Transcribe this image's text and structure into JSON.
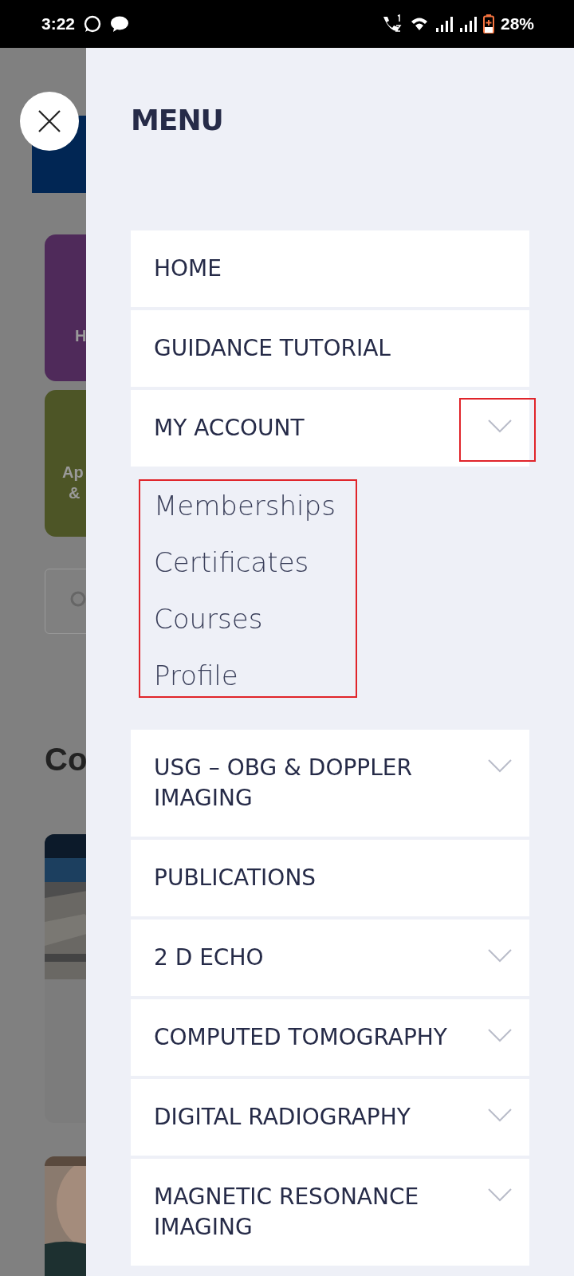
{
  "status_bar": {
    "time": "3:22",
    "battery": "28%"
  },
  "background": {
    "tile_1_text": "H",
    "tile_2_lines": [
      "Ap",
      "&"
    ],
    "section_heading": "Co"
  },
  "menu": {
    "title": "MENU",
    "items": [
      {
        "label": "HOME",
        "expandable": false,
        "annotated": false
      },
      {
        "label": "GUIDANCE TUTORIAL",
        "expandable": false,
        "annotated": false
      },
      {
        "label": "MY ACCOUNT",
        "expandable": true,
        "expanded": true,
        "annotated": true,
        "children": [
          {
            "label": "Memberships"
          },
          {
            "label": "Certificates"
          },
          {
            "label": "Courses"
          },
          {
            "label": "Profile"
          }
        ]
      },
      {
        "label": "USG – OBG & DOPPLER IMAGING",
        "expandable": true,
        "annotated": false
      },
      {
        "label": "PUBLICATIONS",
        "expandable": false,
        "annotated": false
      },
      {
        "label": "2 D ECHO",
        "expandable": true,
        "annotated": false
      },
      {
        "label": "COMPUTED TOMOGRAPHY",
        "expandable": true,
        "annotated": false
      },
      {
        "label": "DIGITAL RADIOGRAPHY",
        "expandable": true,
        "annotated": false
      },
      {
        "label": "MAGNETIC RESONANCE IMAGING",
        "expandable": true,
        "annotated": false
      }
    ]
  }
}
